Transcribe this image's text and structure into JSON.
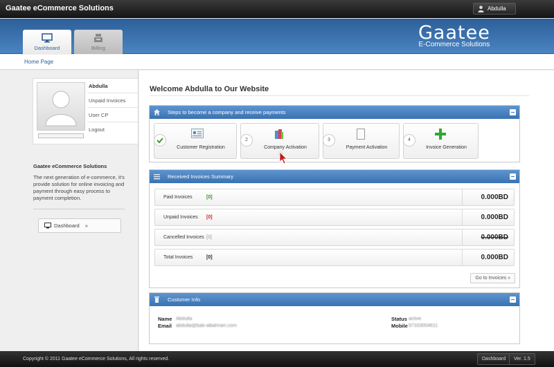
{
  "app": {
    "title": "Gaatee eCommerce Solutions",
    "user": "Abdulla"
  },
  "header": {
    "tabs": [
      {
        "label": "Dashboard",
        "active": true
      },
      {
        "label": "Billing",
        "active": false
      }
    ],
    "logo": {
      "main": "Gaatee",
      "sub": "E-Commerce Solutions"
    }
  },
  "breadcrumb": {
    "label": "Home Page"
  },
  "sidebar": {
    "profile_name": "Abdulla",
    "links": [
      "Unpaid Invoices",
      "User CP",
      "Logout"
    ],
    "about_title": "Gaatee eCommerce Solutions",
    "about_text": "The next generation of e-commerce, it's provide solution for online invoicing and payment through easy process to payment completion.",
    "nav_button": "Dashboard",
    "nav_chevron": "»"
  },
  "main": {
    "welcome": "Welcome Abdulla to Our Website",
    "steps_panel": {
      "title": "Steps to become a company and receive payments",
      "steps": [
        {
          "number": "",
          "label": "Customer Registration",
          "done": true,
          "icon": "registration-card-icon"
        },
        {
          "number": "2",
          "label": "Company Activation",
          "done": false,
          "icon": "company-activation-icon"
        },
        {
          "number": "3",
          "label": "Payment Activation",
          "done": false,
          "icon": "document-icon"
        },
        {
          "number": "4",
          "label": "Invoice Generation",
          "done": false,
          "icon": "plus-icon"
        }
      ]
    },
    "invoices_panel": {
      "title": "Received Invoices Summary",
      "rows": [
        {
          "label": "Paid Invoices",
          "count": "[0]",
          "amount": "0.000BD",
          "count_color": "#2f8f1f",
          "strike": false
        },
        {
          "label": "Unpaid Invoices",
          "count": "[0]",
          "amount": "0.000BD",
          "count_color": "#cc2222",
          "strike": false
        },
        {
          "label": "Cancelled Invoices",
          "count": "[0]",
          "amount": "0.000BD",
          "count_color": "#999999",
          "strike": true
        },
        {
          "label": "Total Invoices",
          "count": "[0]",
          "amount": "0.000BD",
          "count_color": "#222222",
          "strike": false
        }
      ],
      "goto_button": "Go to Invoices »"
    },
    "customer_panel": {
      "title": "Customer Info",
      "name_label": "Name",
      "name_value": "Abdulla",
      "email_label": "Email",
      "email_value": "abdulla@bab-albahrain.com",
      "status_label": "Status",
      "status_value": "active",
      "mobile_label": "Mobile",
      "mobile_value": "97333004611"
    }
  },
  "footer": {
    "copyright": "Copyright © 2011 Gaatee eCommerce Solutions, All rights reserved.",
    "dashboard_button": "Dashboard",
    "version": "Ver. 1.5"
  },
  "colors": {
    "header_blue": "#3a72b2",
    "accent_green": "#2f8f1f",
    "accent_red": "#cc2222"
  }
}
